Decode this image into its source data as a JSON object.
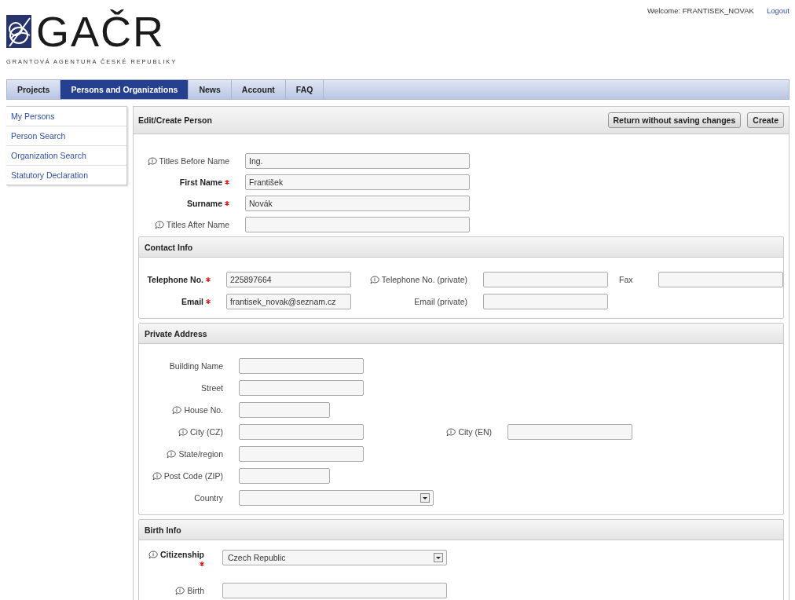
{
  "header": {
    "logo_text": "GAČR",
    "logo_subtitle": "GRANTOVÁ AGENTURA ČESKÉ REPUBLIKY",
    "welcome": "Welcome: FRANTISEK_NOVAK",
    "logout": "Logout"
  },
  "nav": [
    {
      "label": "Projects",
      "selected": false
    },
    {
      "label": "Persons and Organizations",
      "selected": true
    },
    {
      "label": "News",
      "selected": false
    },
    {
      "label": "Account",
      "selected": false
    },
    {
      "label": "FAQ",
      "selected": false
    }
  ],
  "sidebar": {
    "items": [
      "My Persons",
      "Person Search",
      "Organization Search",
      "Statutory Declaration"
    ]
  },
  "panel": {
    "title": "Edit/Create Person",
    "buttons": [
      "Return without saving changes",
      "Create"
    ],
    "fields": [
      {
        "label": "Titles Before Name",
        "info": true,
        "required": false,
        "kind": "text",
        "value": "Ing."
      },
      {
        "label": "First Name",
        "info": false,
        "required": true,
        "kind": "text",
        "value": "František"
      },
      {
        "label": "Surname",
        "info": false,
        "required": true,
        "kind": "text",
        "value": "Novák"
      },
      {
        "label": "Titles After Name",
        "info": true,
        "required": false,
        "kind": "text"
      }
    ],
    "sections": [
      {
        "title": "Contact Info",
        "rows": [
          [
            {
              "label": "Telephone No.",
              "info": false,
              "required": true,
              "kind": "text",
              "value": "225897664"
            },
            {
              "label": "Telephone No. (private)",
              "info": true,
              "required": false,
              "kind": "text"
            },
            {
              "label": "Fax",
              "info": false,
              "required": false,
              "kind": "text"
            }
          ],
          [
            {
              "label": "Email",
              "info": false,
              "required": true,
              "kind": "text",
              "value": "frantisek_novak@seznam.cz"
            },
            {
              "label": "Email (private)",
              "info": false,
              "required": false,
              "kind": "text"
            }
          ]
        ]
      },
      {
        "title": "Private Address",
        "rows": [
          [
            {
              "label": "Building Name",
              "info": false,
              "required": false,
              "kind": "text"
            }
          ],
          [
            {
              "label": "Street",
              "info": false,
              "required": false,
              "kind": "text"
            }
          ],
          [
            {
              "label": "House No.",
              "info": true,
              "required": false,
              "kind": "text"
            }
          ],
          [
            {
              "label": "City (CZ)",
              "info": true,
              "required": false,
              "kind": "text"
            },
            {
              "label": "City (EN)",
              "info": true,
              "required": false,
              "kind": "text"
            }
          ],
          [
            {
              "label": "State/region",
              "info": true,
              "required": false,
              "kind": "text"
            }
          ],
          [
            {
              "label": "Post Code (ZIP)",
              "info": true,
              "required": false,
              "kind": "text"
            }
          ],
          [
            {
              "label": "Country",
              "info": false,
              "required": false,
              "kind": "select"
            }
          ]
        ]
      },
      {
        "title": "Birth Info",
        "rows": [
          [
            {
              "label": "Citizenship",
              "info": true,
              "required": true,
              "kind": "select",
              "value": "Czech Republic"
            }
          ],
          [
            {
              "label": "Birth",
              "info": true,
              "required": false,
              "kind": "text"
            }
          ]
        ]
      }
    ]
  }
}
